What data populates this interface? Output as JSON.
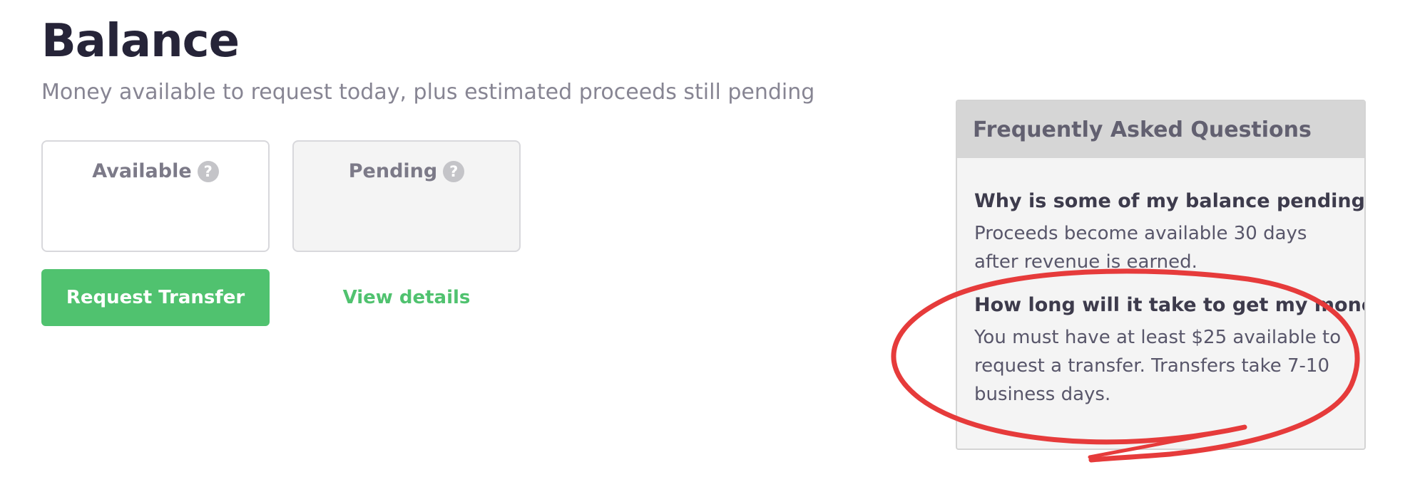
{
  "header": {
    "title": "Balance",
    "subtitle": "Money available to request today, plus estimated proceeds still pending"
  },
  "cards": {
    "available": {
      "label": "Available",
      "help_icon": "question-circle-icon",
      "help_glyph": "?"
    },
    "pending": {
      "label": "Pending",
      "help_icon": "question-circle-icon",
      "help_glyph": "?"
    }
  },
  "actions": {
    "request_transfer_label": "Request Transfer",
    "view_details_label": "View details"
  },
  "faq": {
    "title": "Frequently Asked Questions",
    "items": [
      {
        "question": "Why is some of my balance pending?",
        "answer": "Proceeds become available 30 days after revenue is earned."
      },
      {
        "question": "How long will it take to get my money?",
        "answer": "You must have at least $25 available to request a transfer. Transfers take 7-10 business days."
      }
    ]
  },
  "colors": {
    "accent_green": "#50c26f",
    "title_text": "#262438",
    "annotation_red": "#e63b3b"
  }
}
